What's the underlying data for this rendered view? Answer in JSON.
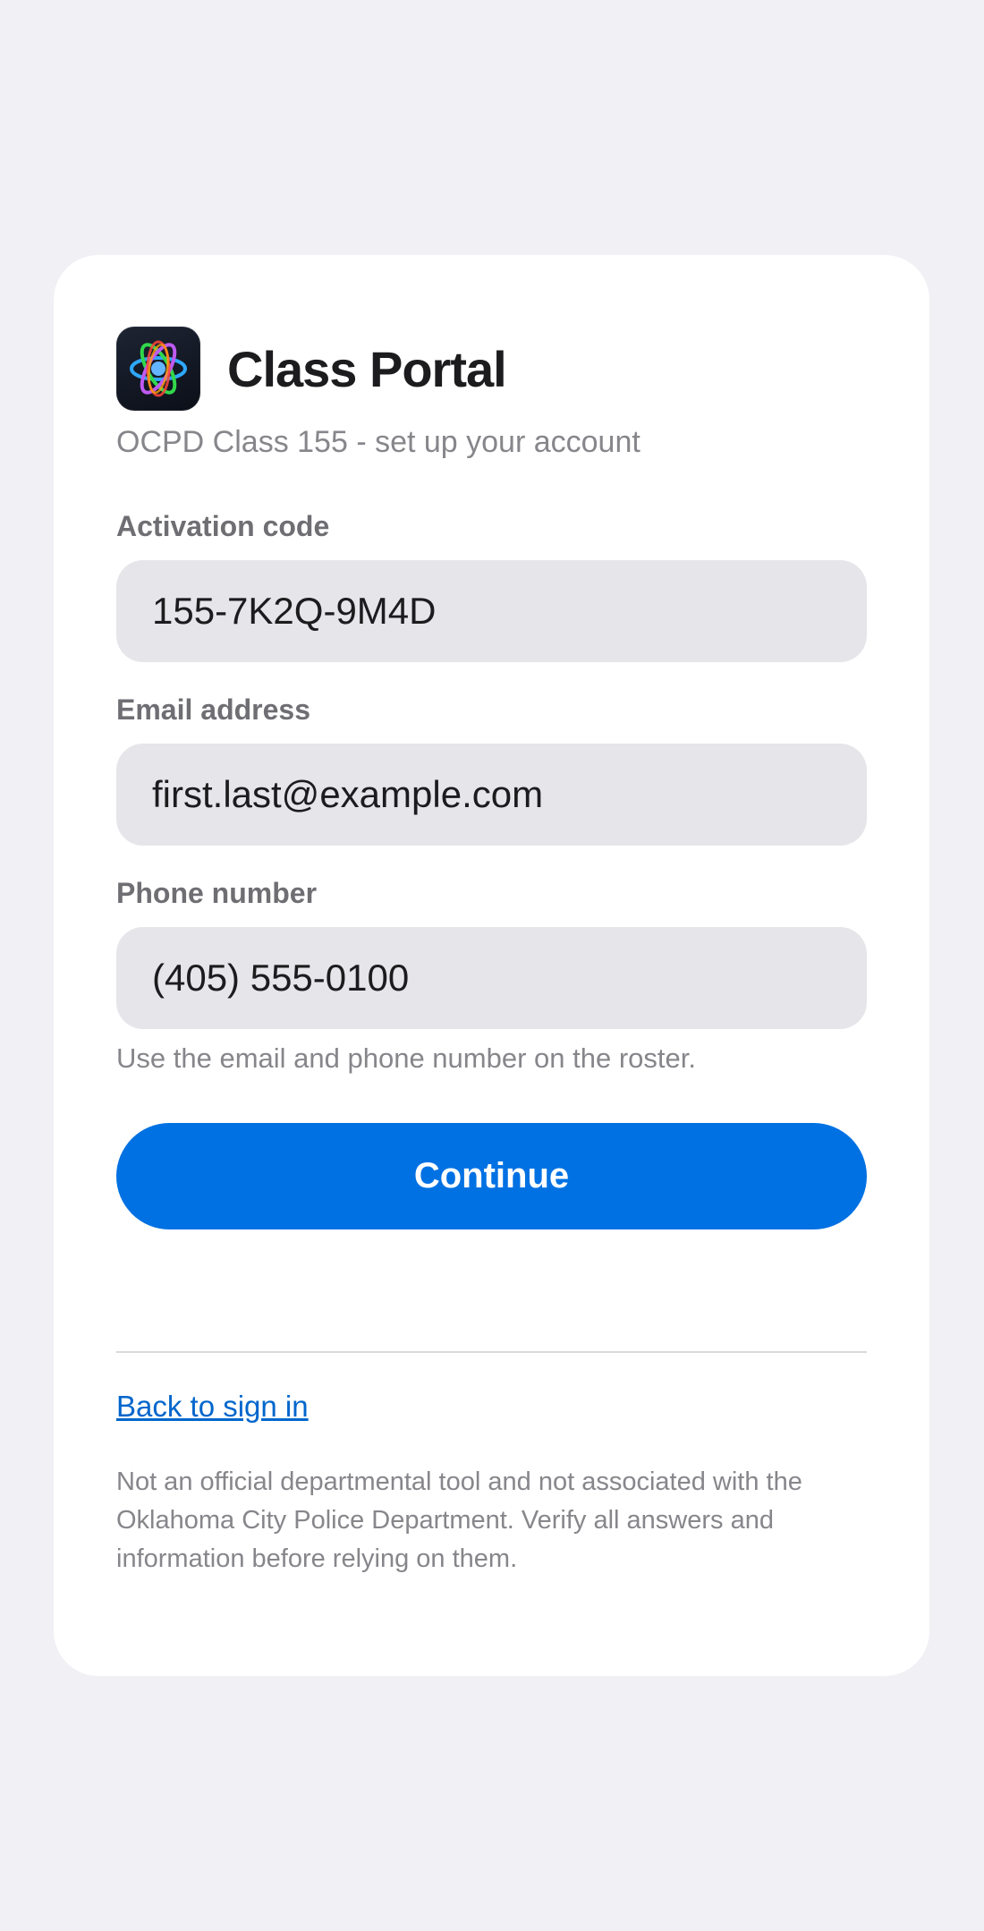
{
  "app": {
    "title": "Class Portal",
    "subtitle": "OCPD Class 155 - set up your account",
    "icon": "atom-icon"
  },
  "form": {
    "activation_code": {
      "label": "Activation code",
      "value": "155-7K2Q-9M4D"
    },
    "email": {
      "label": "Email address",
      "value": "first.last@example.com"
    },
    "phone": {
      "label": "Phone number",
      "value": "(405) 555-0100"
    },
    "helper_text": "Use the email and phone number on the roster.",
    "continue_label": "Continue"
  },
  "footer": {
    "back_link": "Back to sign in",
    "disclaimer": "Not an official departmental tool and not associated with the Oklahoma City Police Department. Verify all answers and information before relying on them."
  },
  "colors": {
    "background": "#f0f0f5",
    "card": "#ffffff",
    "accent": "#0071e3",
    "link": "#0066cc",
    "field": "#e5e5ea"
  }
}
